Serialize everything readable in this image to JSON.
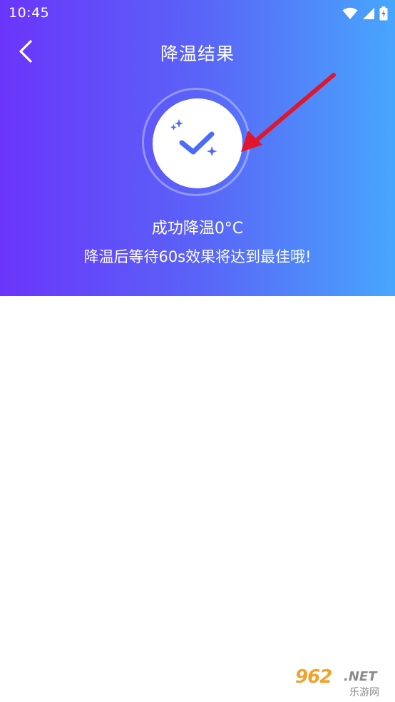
{
  "status_bar": {
    "time": "10:45",
    "icons": [
      "wifi-icon",
      "signal-icon",
      "battery-charging-icon"
    ]
  },
  "nav": {
    "back_icon": "chevron-left-icon",
    "title": "降温结果"
  },
  "result": {
    "icon": "check-sparkle-icon",
    "title": "成功降温0°C",
    "subtitle": "降温后等待60s效果将达到最佳哦!"
  },
  "watermark": {
    "main": "962",
    "domain": ".NET",
    "sub": "乐游网"
  },
  "colors": {
    "gradient_start": "#6a35fb",
    "gradient_end": "#47a6fc",
    "check_color": "#4a6cf7",
    "arrow_color": "#e0172a"
  }
}
